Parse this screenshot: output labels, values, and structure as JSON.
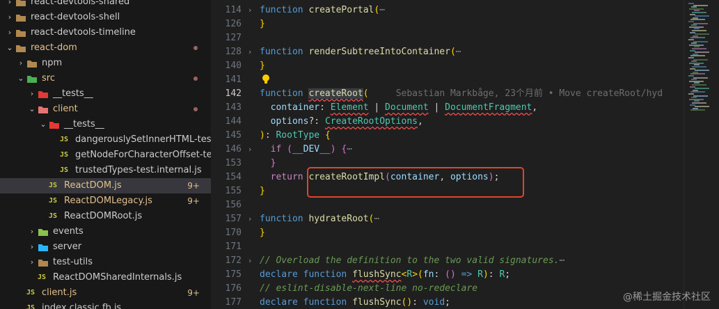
{
  "explorer": {
    "items": [
      {
        "label": "react-devtools-shared",
        "depth": 0,
        "chev": "›",
        "icon": "folder"
      },
      {
        "label": "react-devtools-shell",
        "depth": 0,
        "chev": "›",
        "icon": "folder"
      },
      {
        "label": "react-devtools-timeline",
        "depth": 0,
        "chev": "›",
        "icon": "folder"
      },
      {
        "label": "react-dom",
        "depth": 0,
        "chev": "⌄",
        "icon": "folder-open",
        "dot": true,
        "mod": true
      },
      {
        "label": "npm",
        "depth": 1,
        "chev": "›",
        "icon": "folder"
      },
      {
        "label": "src",
        "depth": 1,
        "chev": "⌄",
        "icon": "folder-src",
        "dot": true,
        "mod": true
      },
      {
        "label": "__tests__",
        "depth": 2,
        "chev": "›",
        "icon": "folder-test"
      },
      {
        "label": "client",
        "depth": 2,
        "chev": "⌄",
        "icon": "folder-client",
        "dot": true,
        "mod": true
      },
      {
        "label": "__tests__",
        "depth": 3,
        "chev": "⌄",
        "icon": "folder-test"
      },
      {
        "label": "dangerouslySetInnerHTML-test.js",
        "depth": 4,
        "icon": "js"
      },
      {
        "label": "getNodeForCharacterOffset-test.js",
        "depth": 4,
        "icon": "js"
      },
      {
        "label": "trustedTypes-test.internal.js",
        "depth": 4,
        "icon": "js"
      },
      {
        "label": "ReactDOM.js",
        "depth": 3,
        "icon": "js",
        "badge": "9+",
        "mod": true,
        "selected": true
      },
      {
        "label": "ReactDOMLegacy.js",
        "depth": 3,
        "icon": "js",
        "badge": "9+",
        "mod": true
      },
      {
        "label": "ReactDOMRoot.js",
        "depth": 3,
        "icon": "js"
      },
      {
        "label": "events",
        "depth": 2,
        "chev": "›",
        "icon": "folder-events"
      },
      {
        "label": "server",
        "depth": 2,
        "chev": "›",
        "icon": "folder-server"
      },
      {
        "label": "test-utils",
        "depth": 2,
        "chev": "›",
        "icon": "folder"
      },
      {
        "label": "ReactDOMSharedInternals.js",
        "depth": 2,
        "icon": "js"
      },
      {
        "label": "client.js",
        "depth": 1,
        "icon": "js",
        "badge": "9+",
        "mod": true
      },
      {
        "label": "index.classic.fb.js",
        "depth": 1,
        "icon": "js"
      }
    ],
    "js_icon_text": "JS"
  },
  "editor": {
    "line_numbers": [
      "114",
      "126",
      "127",
      "128",
      "140",
      "141",
      "142",
      "143",
      "144",
      "145",
      "146",
      "153",
      "154",
      "155",
      "156",
      "157",
      "170",
      "171",
      "172",
      "175",
      "176",
      "177"
    ],
    "current_line": "142",
    "fold_lines": [
      "114",
      "128",
      "146",
      "157",
      "172"
    ],
    "blame": "Sebastian Markbåge, 23个月前 • Move createRoot/hyd",
    "ellipsis": "⋯"
  },
  "watermark": "@稀土掘金技术社区",
  "colors": {
    "accent_box": "#e0452b",
    "badge": "#e2c08d",
    "js": "#cbcb41"
  }
}
